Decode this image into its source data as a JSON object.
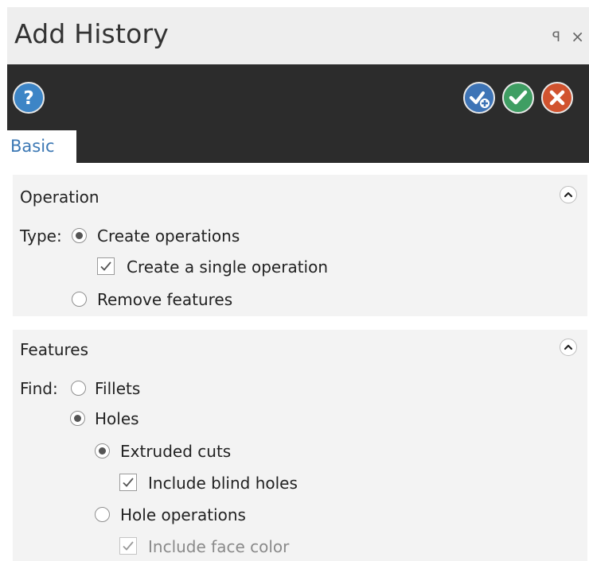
{
  "window": {
    "title": "Add History",
    "pin_icon": "ꟼ",
    "close_icon": "×"
  },
  "toolbar": {
    "help_icon": "?",
    "buttons": [
      "apply-and-next-icon",
      "ok-check-icon",
      "cancel-x-icon"
    ],
    "colors": {
      "bar": "#2c2c2c",
      "help": "#3d85c6",
      "apply_next": "#3e74b6",
      "ok": "#3f9e63",
      "cancel": "#d1532f"
    }
  },
  "tabs": [
    {
      "label": "Basic",
      "active": true
    }
  ],
  "operation": {
    "title": "Operation",
    "type_label": "Type:",
    "create_operations": {
      "label": "Create operations",
      "selected": true
    },
    "single_operation": {
      "label": "Create a single operation",
      "checked": true
    },
    "remove_features": {
      "label": "Remove features",
      "selected": false
    }
  },
  "features": {
    "title": "Features",
    "find_label": "Find:",
    "fillets": {
      "label": "Fillets",
      "selected": false
    },
    "holes": {
      "label": "Holes",
      "selected": true
    },
    "extruded_cuts": {
      "label": "Extruded cuts",
      "selected": true
    },
    "include_blind_holes": {
      "label": "Include blind holes",
      "checked": true
    },
    "hole_operations": {
      "label": "Hole operations",
      "selected": false
    },
    "include_face_color": {
      "label": "Include face color",
      "checked": true,
      "disabled": true
    }
  }
}
